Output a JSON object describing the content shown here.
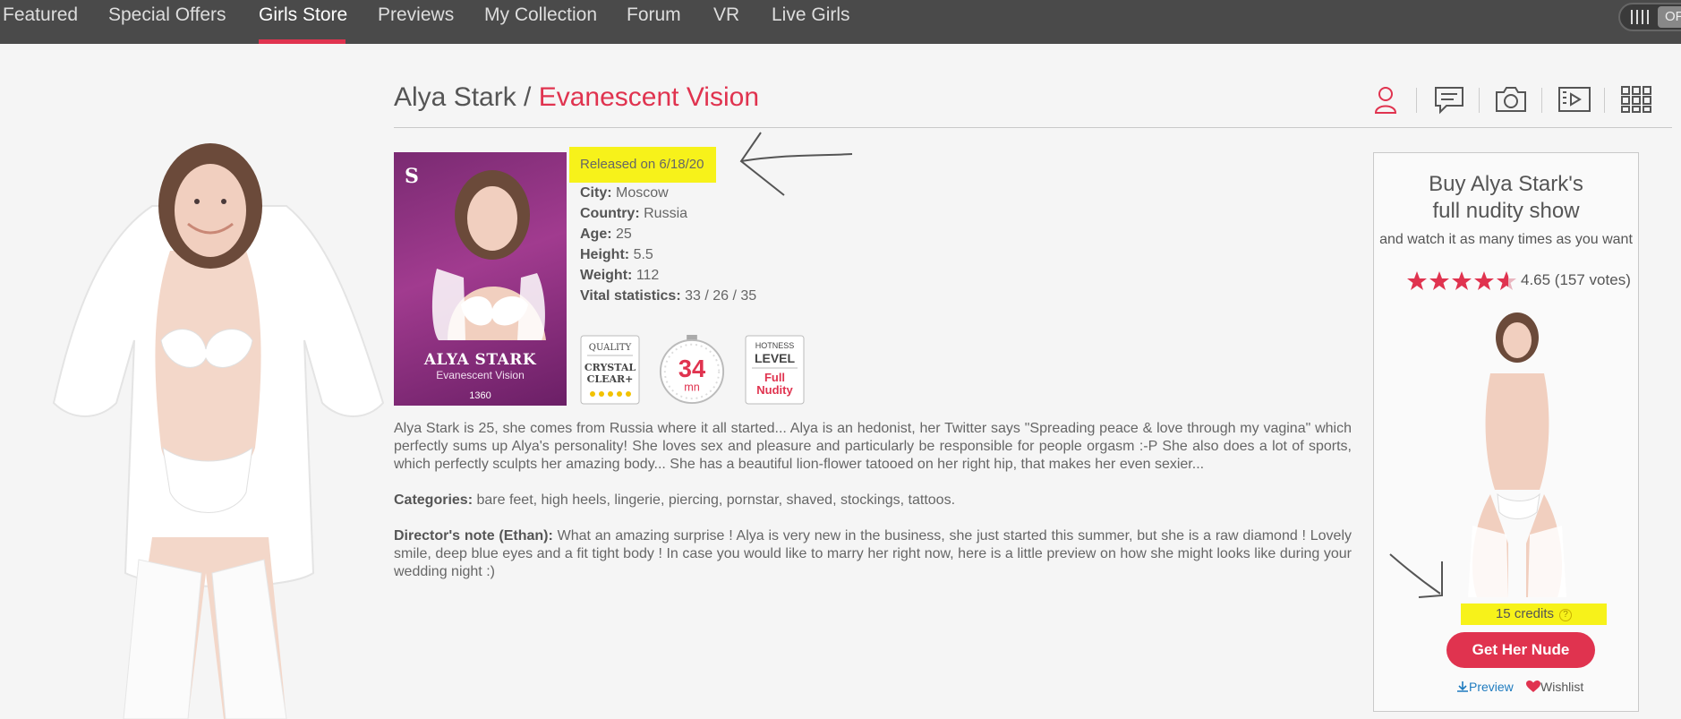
{
  "nav": {
    "items": [
      "Featured",
      "Special Offers",
      "Girls Store",
      "Previews",
      "My Collection",
      "Forum",
      "VR",
      "Live Girls"
    ],
    "active": "Girls Store",
    "toggle_label": "OF"
  },
  "header": {
    "model": "Alya Stark",
    "separator": " / ",
    "show": "Evanescent Vision",
    "icons": [
      "user-icon",
      "chat-icon",
      "camera-icon",
      "video-icon",
      "grid-icon"
    ]
  },
  "cover": {
    "badge": "S",
    "name": "ALYA STARK",
    "show": "Evanescent Vision",
    "number": "1360"
  },
  "released": "Released on 6/18/20",
  "info": [
    {
      "label": "City:",
      "value": "Moscow"
    },
    {
      "label": "Country:",
      "value": "Russia"
    },
    {
      "label": "Age:",
      "value": "25"
    },
    {
      "label": "Height:",
      "value": "5.5"
    },
    {
      "label": "Weight:",
      "value": "112"
    },
    {
      "label": "Vital statistics:",
      "value": "33 / 26 / 35"
    }
  ],
  "badges": {
    "quality": {
      "top": "QUALITY",
      "line1": "CRYSTAL",
      "line2": "CLEAR+"
    },
    "duration": {
      "value": "34",
      "unit": "mn"
    },
    "hotness": {
      "top": "HOTNESS",
      "mid": "LEVEL",
      "line1": "Full",
      "line2": "Nudity"
    }
  },
  "description": "Alya Stark is 25, she comes from Russia where it all started... Alya is an hedonist, her Twitter says \"Spreading peace & love through my vagina\" which perfectly sums up Alya's personality! She loves sex and pleasure and particularly be responsible for people orgasm :-P She also does a lot of sports, which perfectly sculpts her amazing body... She has a beautiful lion-flower tatooed on her right hip, that makes her even sexier...",
  "categories": {
    "label": "Categories:",
    "value": "bare feet, high heels, lingerie, piercing, pornstar, shaved, stockings, tattoos."
  },
  "director_note": {
    "label": "Director's note (Ethan):",
    "value": "What an amazing surprise ! Alya is very new in the business, she just started this summer, but she is a raw diamond ! Lovely smile, deep blue eyes and a fit tight body ! In case you would like to marry her right now, here is a little preview on how she might looks like during your wedding night :)"
  },
  "buy": {
    "title_line1": "Buy Alya Stark's",
    "title_line2": "full nudity show",
    "subtitle": "and watch it as many times as you want",
    "rating_value": 4.65,
    "rating_text": "4.65 (157 votes)",
    "credits": "15 credits",
    "help_glyph": "?",
    "cta": "Get Her Nude",
    "preview": "Preview",
    "wishlist": "Wishlist"
  },
  "colors": {
    "accent": "#e0334f",
    "nav_bg": "#4a4a4a",
    "highlight": "#f7f21a",
    "link": "#1e7bbf"
  }
}
